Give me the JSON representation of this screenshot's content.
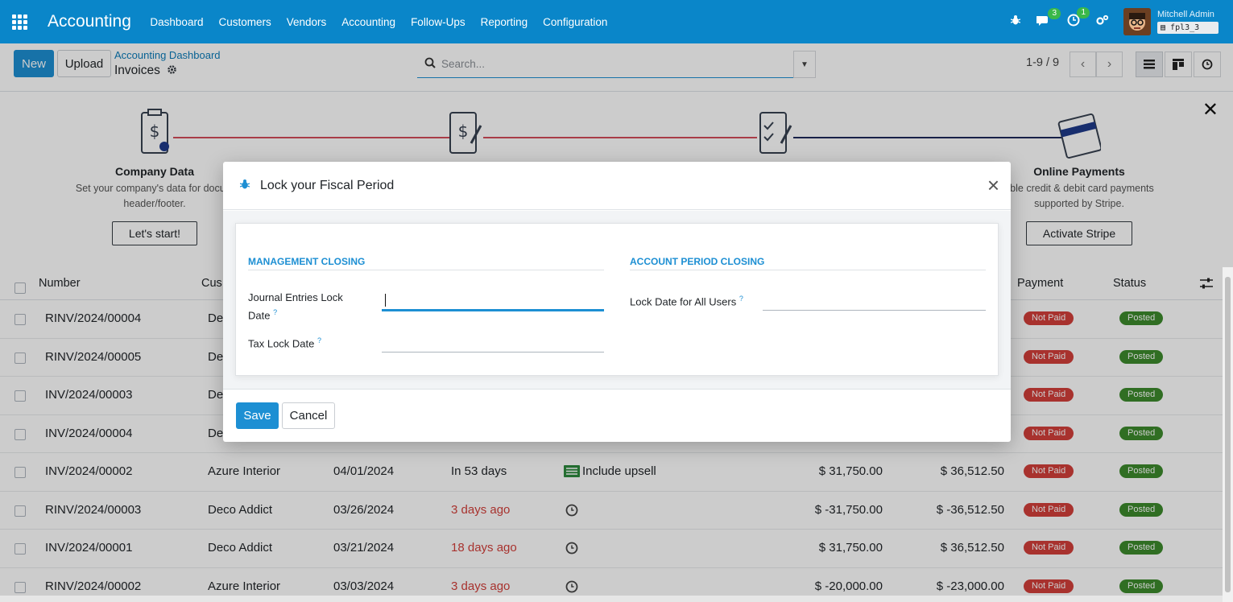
{
  "navbar": {
    "brand": "Accounting",
    "menu": [
      "Dashboard",
      "Customers",
      "Vendors",
      "Accounting",
      "Follow-Ups",
      "Reporting",
      "Configuration"
    ],
    "messages_count": "3",
    "activities_count": "1",
    "user_name": "Mitchell Admin",
    "db_name": "fpl3_3",
    "color": "#0a86c9"
  },
  "control": {
    "new_label": "New",
    "upload_label": "Upload",
    "breadcrumb": "Accounting Dashboard",
    "title": "Invoices",
    "search_placeholder": "Search...",
    "pager": "1-9 / 9",
    "prev": "‹",
    "next": "›"
  },
  "onboarding": {
    "close": "✕",
    "steps": [
      {
        "title": "Company Data",
        "desc_line1": "Set your company's data for docum",
        "desc_line2": "header/footer.",
        "button": "Let's start!"
      },
      {
        "title": "Online Payments",
        "desc_line1": "able credit & debit card payments",
        "desc_line2": "supported by Stripe.",
        "button": "Activate Stripe"
      }
    ]
  },
  "table": {
    "headers": {
      "number": "Number",
      "customer": "Cus",
      "payment": "Payment",
      "status": "Status"
    },
    "rows": [
      {
        "number": "RINV/2024/00004",
        "customer": "De",
        "payment": "Not Paid",
        "status": "Posted"
      },
      {
        "number": "RINV/2024/00005",
        "customer": "De",
        "payment": "Not Paid",
        "status": "Posted"
      },
      {
        "number": "INV/2024/00003",
        "customer": "De",
        "payment": "Not Paid",
        "status": "Posted"
      },
      {
        "number": "INV/2024/00004",
        "customer": "De",
        "payment": "Not Paid",
        "status": "Posted"
      },
      {
        "number": "INV/2024/00002",
        "customer": "Azure Interior",
        "date": "04/01/2024",
        "due": "In 53 days",
        "due_overdue": false,
        "activity": "Include upsell",
        "untaxed": "$ 31,750.00",
        "total": "$ 36,512.50",
        "payment": "Not Paid",
        "status": "Posted"
      },
      {
        "number": "RINV/2024/00003",
        "customer": "Deco Addict",
        "date": "03/26/2024",
        "due": "3 days ago",
        "due_overdue": true,
        "untaxed": "$ -31,750.00",
        "total": "$ -36,512.50",
        "payment": "Not Paid",
        "status": "Posted"
      },
      {
        "number": "INV/2024/00001",
        "customer": "Deco Addict",
        "date": "03/21/2024",
        "due": "18 days ago",
        "due_overdue": true,
        "untaxed": "$ 31,750.00",
        "total": "$ 36,512.50",
        "payment": "Not Paid",
        "status": "Posted"
      },
      {
        "number": "RINV/2024/00002",
        "customer": "Azure Interior",
        "date": "03/03/2024",
        "due": "3 days ago",
        "due_overdue": true,
        "untaxed": "$ -20,000.00",
        "total": "$ -23,000.00",
        "payment": "Not Paid",
        "status": "Posted"
      }
    ]
  },
  "modal": {
    "title": "Lock your Fiscal Period",
    "close": "×",
    "management_title": "MANAGEMENT CLOSING",
    "account_title": "ACCOUNT PERIOD CLOSING",
    "journal_lock_label_line1": "Journal Entries Lock",
    "journal_lock_label_line2": "Date",
    "tax_lock_label": "Tax Lock Date",
    "all_users_label": "Lock Date for All Users",
    "help": "?",
    "save_label": "Save",
    "cancel_label": "Cancel"
  }
}
